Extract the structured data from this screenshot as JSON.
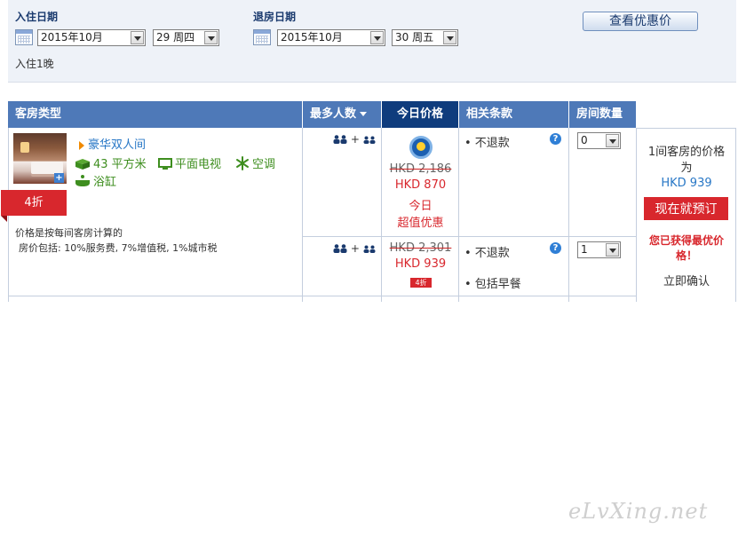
{
  "search": {
    "checkin_label": "入住日期",
    "checkin_month": "2015年10月",
    "checkin_day": "29 周四",
    "checkout_label": "退房日期",
    "checkout_month": "2015年10月",
    "checkout_day": "30 周五",
    "nights": "入住1晚",
    "deals_button": "查看优惠价"
  },
  "table": {
    "headers": {
      "room_type": "客房类型",
      "max_guests": "最多人数",
      "today_price": "今日价格",
      "terms": "相关条款",
      "room_count": "房间数量"
    }
  },
  "room": {
    "name": "豪华双人间",
    "discount": "4折",
    "amenities": {
      "area": "43 平方米",
      "tv": "平面电视",
      "ac": "空调",
      "bath": "浴缸"
    },
    "price_note_1": "价格是按每间客房计算的",
    "price_note_2": "房价包括: 10%服务费, 7%增值税, 1%城市税"
  },
  "rates": [
    {
      "occupancy": "+",
      "original_price": "HKD 2,186",
      "price": "HKD 870",
      "promo_line_1": "今日",
      "promo_line_2": "超值优惠",
      "terms": [
        "• 不退款"
      ],
      "quantity": "0"
    },
    {
      "occupancy": "+",
      "original_price": "HKD 2,301",
      "price": "HKD 939",
      "discount_tag": "4折",
      "terms": [
        "• 不退款",
        "• 包括早餐"
      ],
      "quantity": "1"
    }
  ],
  "summary": {
    "line_1": "1间客房的价格",
    "line_2": "为",
    "price": "HKD 939",
    "book_button": "现在就预订",
    "best_price_1": "您已获得最优价",
    "best_price_2": "格！",
    "instant": "立即确认"
  },
  "watermark": "eLvXing.net",
  "colors": {
    "header_blue": "#4e79b8",
    "header_active": "#0f3c7d",
    "accent_red": "#d8272d",
    "link_blue": "#2877c6",
    "amenity_green": "#3e8e1f",
    "panel_bg": "#eef2f8"
  }
}
